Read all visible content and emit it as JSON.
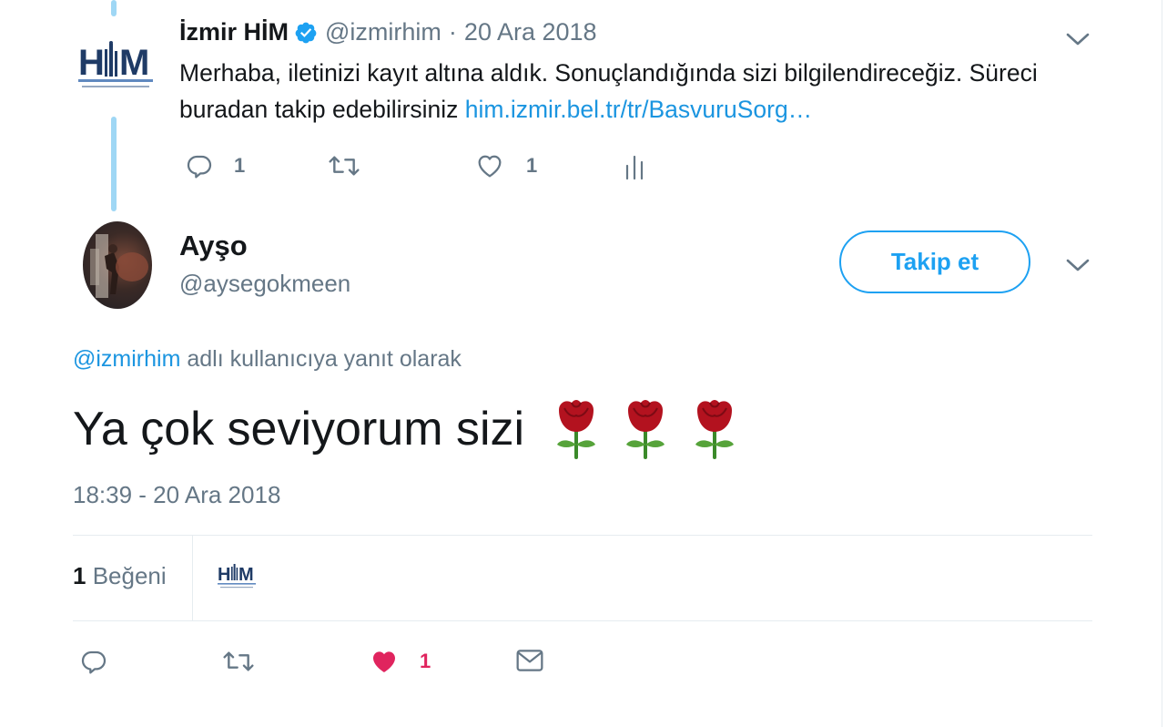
{
  "parent_tweet": {
    "author_name": "İzmir HİM",
    "verified": true,
    "handle": "@izmirhim",
    "separator": "·",
    "date": "20 Ara 2018",
    "text": "Merhaba, iletinizi kayıt altına aldık. Sonuçlandığında sizi bilgilendireceğiz. Süreci buradan takip edebilirsiniz ",
    "link": "him.izmir.bel.tr/tr/BasvuruSorg…",
    "logo_text": "HİM",
    "reply_count": "1",
    "like_count": "1",
    "icons": [
      "reply-icon",
      "retweet-icon",
      "heart-outline-icon",
      "analytics-icon",
      "chevron-down-icon"
    ]
  },
  "main_tweet": {
    "author_name": "Ayşo",
    "handle": "@aysegokmeen",
    "follow_label": "Takip et",
    "reply_mention": "@izmirhim",
    "reply_suffix": " adlı kullanıcıya yanıt olarak",
    "text": "Ya çok seviyorum sizi",
    "emoji": [
      "rose",
      "rose",
      "rose"
    ],
    "timestamp": "18:39 - 20 Ara 2018",
    "likes_count": "1",
    "likes_label": "Beğeni",
    "action_like_count": "1",
    "icons": [
      "reply-icon",
      "retweet-icon",
      "heart-filled-icon",
      "mail-icon",
      "chevron-down-icon"
    ]
  },
  "colors": {
    "accent": "#1da1f2",
    "link": "#1b95e0",
    "muted": "#657786",
    "text": "#14171a",
    "like": "#e0245e",
    "thread_line": "#9fd7f5",
    "divider": "#e6ecf0"
  }
}
